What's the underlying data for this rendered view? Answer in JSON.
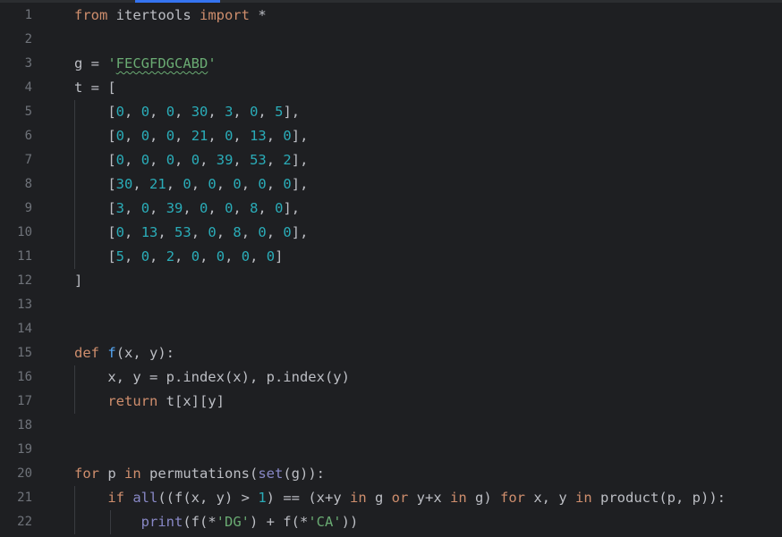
{
  "editor": {
    "lines": [
      {
        "n": "1",
        "indent": 0,
        "tokens": [
          {
            "t": "from",
            "c": "kw"
          },
          {
            "t": " itertools "
          },
          {
            "t": "import",
            "c": "kw"
          },
          {
            "t": " *"
          }
        ]
      },
      {
        "n": "2",
        "indent": 0,
        "tokens": []
      },
      {
        "n": "3",
        "indent": 0,
        "tokens": [
          {
            "t": "g = "
          },
          {
            "t": "'",
            "c": "str"
          },
          {
            "t": "FECGFDGCABD",
            "c": "str typo"
          },
          {
            "t": "'",
            "c": "str"
          }
        ]
      },
      {
        "n": "4",
        "indent": 0,
        "tokens": [
          {
            "t": "t = ["
          }
        ]
      },
      {
        "n": "5",
        "indent": 1,
        "tokens": [
          {
            "t": "    ["
          },
          {
            "t": "0",
            "c": "num-lit"
          },
          {
            "t": ", "
          },
          {
            "t": "0",
            "c": "num-lit"
          },
          {
            "t": ", "
          },
          {
            "t": "0",
            "c": "num-lit"
          },
          {
            "t": ", "
          },
          {
            "t": "30",
            "c": "num-lit"
          },
          {
            "t": ", "
          },
          {
            "t": "3",
            "c": "num-lit"
          },
          {
            "t": ", "
          },
          {
            "t": "0",
            "c": "num-lit"
          },
          {
            "t": ", "
          },
          {
            "t": "5",
            "c": "num-lit"
          },
          {
            "t": "],"
          }
        ]
      },
      {
        "n": "6",
        "indent": 1,
        "tokens": [
          {
            "t": "    ["
          },
          {
            "t": "0",
            "c": "num-lit"
          },
          {
            "t": ", "
          },
          {
            "t": "0",
            "c": "num-lit"
          },
          {
            "t": ", "
          },
          {
            "t": "0",
            "c": "num-lit"
          },
          {
            "t": ", "
          },
          {
            "t": "21",
            "c": "num-lit"
          },
          {
            "t": ", "
          },
          {
            "t": "0",
            "c": "num-lit"
          },
          {
            "t": ", "
          },
          {
            "t": "13",
            "c": "num-lit"
          },
          {
            "t": ", "
          },
          {
            "t": "0",
            "c": "num-lit"
          },
          {
            "t": "],"
          }
        ]
      },
      {
        "n": "7",
        "indent": 1,
        "tokens": [
          {
            "t": "    ["
          },
          {
            "t": "0",
            "c": "num-lit"
          },
          {
            "t": ", "
          },
          {
            "t": "0",
            "c": "num-lit"
          },
          {
            "t": ", "
          },
          {
            "t": "0",
            "c": "num-lit"
          },
          {
            "t": ", "
          },
          {
            "t": "0",
            "c": "num-lit"
          },
          {
            "t": ", "
          },
          {
            "t": "39",
            "c": "num-lit"
          },
          {
            "t": ", "
          },
          {
            "t": "53",
            "c": "num-lit"
          },
          {
            "t": ", "
          },
          {
            "t": "2",
            "c": "num-lit"
          },
          {
            "t": "],"
          }
        ]
      },
      {
        "n": "8",
        "indent": 1,
        "tokens": [
          {
            "t": "    ["
          },
          {
            "t": "30",
            "c": "num-lit"
          },
          {
            "t": ", "
          },
          {
            "t": "21",
            "c": "num-lit"
          },
          {
            "t": ", "
          },
          {
            "t": "0",
            "c": "num-lit"
          },
          {
            "t": ", "
          },
          {
            "t": "0",
            "c": "num-lit"
          },
          {
            "t": ", "
          },
          {
            "t": "0",
            "c": "num-lit"
          },
          {
            "t": ", "
          },
          {
            "t": "0",
            "c": "num-lit"
          },
          {
            "t": ", "
          },
          {
            "t": "0",
            "c": "num-lit"
          },
          {
            "t": "],"
          }
        ]
      },
      {
        "n": "9",
        "indent": 1,
        "tokens": [
          {
            "t": "    ["
          },
          {
            "t": "3",
            "c": "num-lit"
          },
          {
            "t": ", "
          },
          {
            "t": "0",
            "c": "num-lit"
          },
          {
            "t": ", "
          },
          {
            "t": "39",
            "c": "num-lit"
          },
          {
            "t": ", "
          },
          {
            "t": "0",
            "c": "num-lit"
          },
          {
            "t": ", "
          },
          {
            "t": "0",
            "c": "num-lit"
          },
          {
            "t": ", "
          },
          {
            "t": "8",
            "c": "num-lit"
          },
          {
            "t": ", "
          },
          {
            "t": "0",
            "c": "num-lit"
          },
          {
            "t": "],"
          }
        ]
      },
      {
        "n": "10",
        "indent": 1,
        "tokens": [
          {
            "t": "    ["
          },
          {
            "t": "0",
            "c": "num-lit"
          },
          {
            "t": ", "
          },
          {
            "t": "13",
            "c": "num-lit"
          },
          {
            "t": ", "
          },
          {
            "t": "53",
            "c": "num-lit"
          },
          {
            "t": ", "
          },
          {
            "t": "0",
            "c": "num-lit"
          },
          {
            "t": ", "
          },
          {
            "t": "8",
            "c": "num-lit"
          },
          {
            "t": ", "
          },
          {
            "t": "0",
            "c": "num-lit"
          },
          {
            "t": ", "
          },
          {
            "t": "0",
            "c": "num-lit"
          },
          {
            "t": "],"
          }
        ]
      },
      {
        "n": "11",
        "indent": 1,
        "tokens": [
          {
            "t": "    ["
          },
          {
            "t": "5",
            "c": "num-lit"
          },
          {
            "t": ", "
          },
          {
            "t": "0",
            "c": "num-lit"
          },
          {
            "t": ", "
          },
          {
            "t": "2",
            "c": "num-lit"
          },
          {
            "t": ", "
          },
          {
            "t": "0",
            "c": "num-lit"
          },
          {
            "t": ", "
          },
          {
            "t": "0",
            "c": "num-lit"
          },
          {
            "t": ", "
          },
          {
            "t": "0",
            "c": "num-lit"
          },
          {
            "t": ", "
          },
          {
            "t": "0",
            "c": "num-lit"
          },
          {
            "t": "]"
          }
        ]
      },
      {
        "n": "12",
        "indent": 0,
        "tokens": [
          {
            "t": "]"
          }
        ]
      },
      {
        "n": "13",
        "indent": 0,
        "tokens": []
      },
      {
        "n": "14",
        "indent": 0,
        "tokens": []
      },
      {
        "n": "15",
        "indent": 0,
        "tokens": [
          {
            "t": "def",
            "c": "kw"
          },
          {
            "t": " "
          },
          {
            "t": "f",
            "c": "fn"
          },
          {
            "t": "(x, y):"
          }
        ]
      },
      {
        "n": "16",
        "indent": 1,
        "tokens": [
          {
            "t": "    x, y = p.index(x), p.index(y)"
          }
        ]
      },
      {
        "n": "17",
        "indent": 1,
        "tokens": [
          {
            "t": "    "
          },
          {
            "t": "return",
            "c": "kw"
          },
          {
            "t": " t[x][y]"
          }
        ]
      },
      {
        "n": "18",
        "indent": 0,
        "tokens": []
      },
      {
        "n": "19",
        "indent": 0,
        "tokens": []
      },
      {
        "n": "20",
        "indent": 0,
        "tokens": [
          {
            "t": "for",
            "c": "kw"
          },
          {
            "t": " p "
          },
          {
            "t": "in",
            "c": "kw"
          },
          {
            "t": " permutations("
          },
          {
            "t": "set",
            "c": "bi"
          },
          {
            "t": "(g)):"
          }
        ]
      },
      {
        "n": "21",
        "indent": 1,
        "tokens": [
          {
            "t": "    "
          },
          {
            "t": "if",
            "c": "kw"
          },
          {
            "t": " "
          },
          {
            "t": "all",
            "c": "bi"
          },
          {
            "t": "((f(x, y) > "
          },
          {
            "t": "1",
            "c": "num-lit"
          },
          {
            "t": ") == (x+y "
          },
          {
            "t": "in",
            "c": "kw"
          },
          {
            "t": " g "
          },
          {
            "t": "or",
            "c": "kw"
          },
          {
            "t": " y+x "
          },
          {
            "t": "in",
            "c": "kw"
          },
          {
            "t": " g) "
          },
          {
            "t": "for",
            "c": "kw"
          },
          {
            "t": " x, y "
          },
          {
            "t": "in",
            "c": "kw"
          },
          {
            "t": " product(p, p)):"
          }
        ]
      },
      {
        "n": "22",
        "indent": 2,
        "tokens": [
          {
            "t": "        "
          },
          {
            "t": "print",
            "c": "bi"
          },
          {
            "t": "(f(*"
          },
          {
            "t": "'DG'",
            "c": "str"
          },
          {
            "t": ") + f(*"
          },
          {
            "t": "'CA'",
            "c": "str"
          },
          {
            "t": "))"
          }
        ]
      }
    ]
  }
}
